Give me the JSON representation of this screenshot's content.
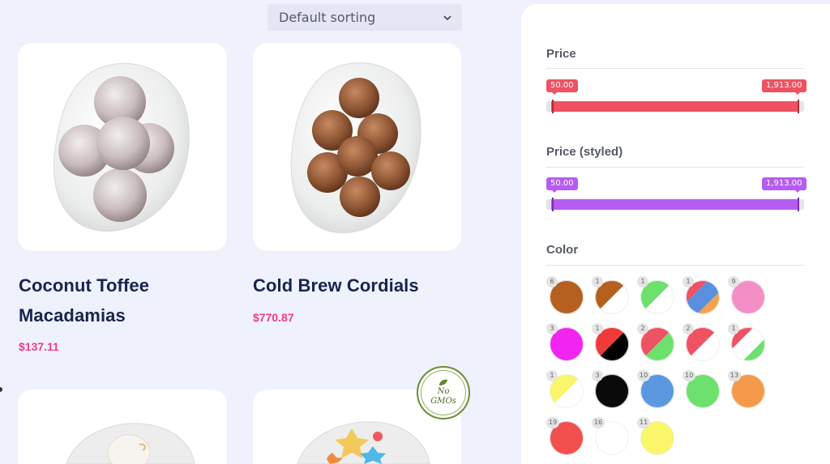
{
  "sorting": {
    "selected": "Default sorting",
    "icon": "chevron-down-icon"
  },
  "products": [
    {
      "title_lines": [
        "Coconut Toffee",
        "Macadamias"
      ],
      "price": "$137.11"
    },
    {
      "title_lines": [
        "Cold Brew Cordials"
      ],
      "price": "$770.87"
    }
  ],
  "badge": {
    "line1": "No",
    "line2": "GMOs",
    "icon": "leaf-icon"
  },
  "colors": {
    "accent_pink": "#f13b8c",
    "title_navy": "#16244f",
    "price_red": "#ef5262",
    "price_purple": "#b65cf2"
  },
  "sidebar": {
    "price": {
      "title": "Price",
      "min": "50.00",
      "max": "1,913.00"
    },
    "price_styled": {
      "title": "Price (styled)",
      "min": "50.00",
      "max": "1,913.00"
    },
    "color": {
      "title": "Color",
      "swatches": [
        {
          "count": "6",
          "colors": [
            "#b5601f"
          ]
        },
        {
          "count": "1",
          "colors": [
            "#b5601f",
            "#ffffff"
          ]
        },
        {
          "count": "1",
          "colors": [
            "#6ee06e",
            "#ffffff"
          ]
        },
        {
          "count": "1",
          "colors": [
            "#ef5262",
            "#5b8fe0",
            "#f4a34a"
          ]
        },
        {
          "count": "9",
          "colors": [
            "#f48fc6"
          ]
        },
        {
          "count": "3",
          "colors": [
            "#f026f0"
          ]
        },
        {
          "count": "1",
          "colors": [
            "#ef3a3a",
            "#000000"
          ]
        },
        {
          "count": "2",
          "colors": [
            "#ef5262",
            "#6ee06e"
          ]
        },
        {
          "count": "2",
          "colors": [
            "#ef5262",
            "#ffffff"
          ]
        },
        {
          "count": "1",
          "colors": [
            "#ef5262",
            "#ffffff",
            "#6ee06e"
          ]
        },
        {
          "count": "1",
          "colors": [
            "#f9f66a",
            "#ffffff"
          ]
        },
        {
          "count": "3",
          "colors": [
            "#0a0a0a"
          ]
        },
        {
          "count": "10",
          "colors": [
            "#5b98e0"
          ]
        },
        {
          "count": "10",
          "colors": [
            "#6ee06e"
          ]
        },
        {
          "count": "13",
          "colors": [
            "#f49a4a"
          ]
        },
        {
          "count": "19",
          "colors": [
            "#f24f4f"
          ]
        },
        {
          "count": "16",
          "colors": [
            "#ffffff"
          ]
        },
        {
          "count": "11",
          "colors": [
            "#f9f66a"
          ]
        }
      ]
    }
  }
}
